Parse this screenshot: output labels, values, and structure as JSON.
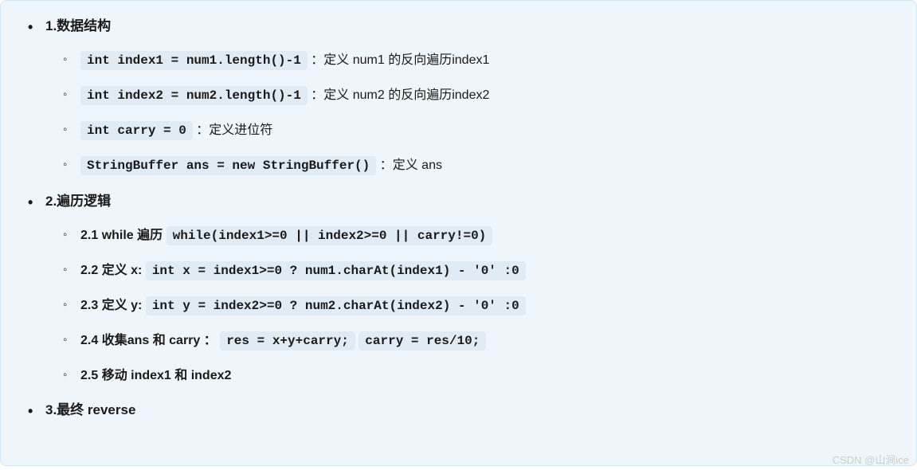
{
  "sections": [
    {
      "title": "1.数据结构",
      "items": [
        {
          "code": "int index1 = num1.length()-1",
          "desc": "：定义 num1 的反向遍历index1"
        },
        {
          "code": "int index2 = num2.length()-1",
          "desc": "：定义 num2 的反向遍历index2"
        },
        {
          "code": "int carry = 0",
          "desc": "：定义进位符"
        },
        {
          "code": "StringBuffer ans = new StringBuffer()",
          "desc": "：定义 ans"
        }
      ]
    },
    {
      "title": "2.遍历逻辑",
      "items": [
        {
          "bold": "2.1 while 遍历",
          "code": "while(index1>=0 || index2>=0  || carry!=0)"
        },
        {
          "bold": "2.2 定义 x:",
          "code": "int x = index1>=0 ? num1.charAt(index1) - '0' :0"
        },
        {
          "bold": "2.3 定义 y:",
          "code": "int y = index2>=0 ? num2.charAt(index2) - '0' :0"
        },
        {
          "bold": "2.4 收集ans 和 carry ：",
          "code": "res = x+y+carry;",
          "code2": "carry = res/10;"
        },
        {
          "bold": "2.5 移动 index1 和 index2"
        }
      ]
    },
    {
      "title": "3.最终 reverse"
    }
  ],
  "watermark": "CSDN @山涧ice"
}
